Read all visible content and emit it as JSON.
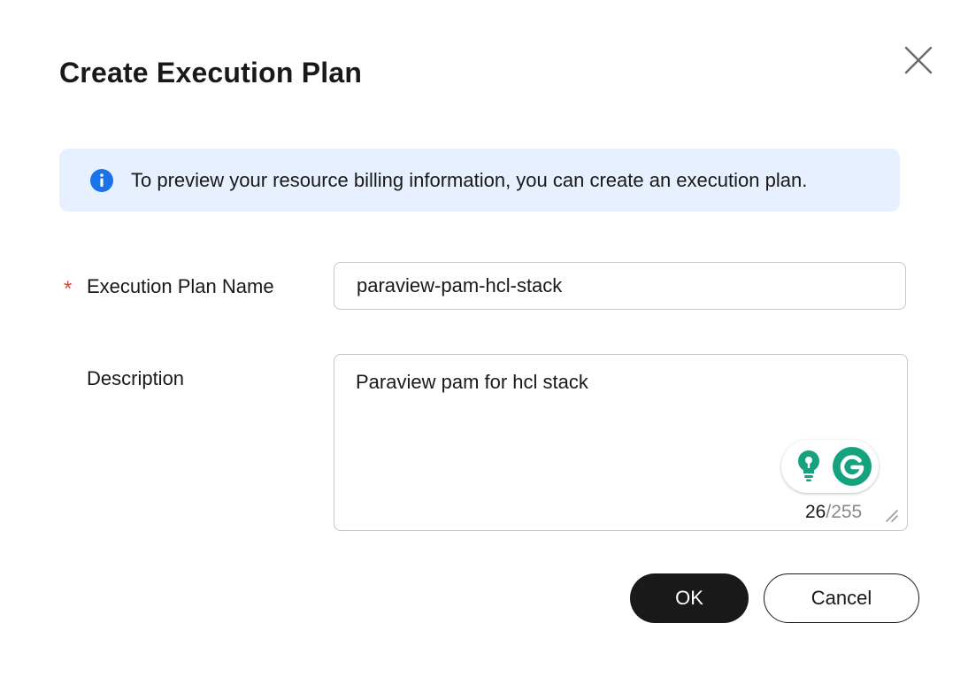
{
  "dialog": {
    "title": "Create Execution Plan",
    "close_icon": "close-icon"
  },
  "alert": {
    "icon": "info-icon",
    "text": "To preview your resource billing information, you can create an execution plan."
  },
  "form": {
    "name_field": {
      "required_mark": "*",
      "label": "Execution Plan Name",
      "value": "paraview-pam-hcl-stack"
    },
    "description_field": {
      "label": "Description",
      "value": "Paraview pam for hcl stack",
      "count_current": "26",
      "count_max": "/255"
    }
  },
  "footer": {
    "ok_label": "OK",
    "cancel_label": "Cancel"
  },
  "colors": {
    "alert_background": "#e6f0ff",
    "info_icon": "#1a73e8",
    "required": "#e4443b",
    "primary_button": "#191919",
    "grammarly": "#15a37f"
  }
}
